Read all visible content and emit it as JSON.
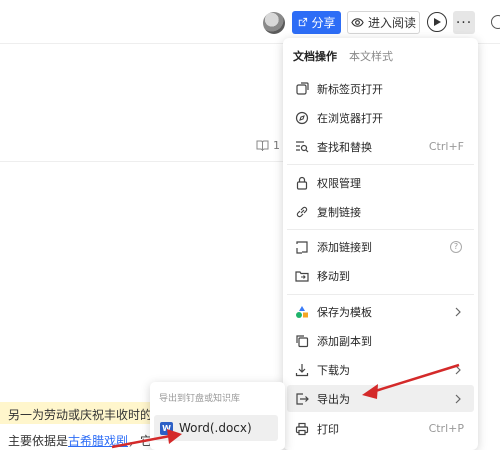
{
  "toolbar": {
    "share_label": "分享",
    "read_label": "进入阅读",
    "more_label": "···"
  },
  "doc": {
    "comment_count": "1",
    "line1": "另一为劳动或庆祝丰收时的",
    "line2_prefix": "主要依据是",
    "line2_link": "古希腊戏剧",
    "line2_suffix": "，它"
  },
  "menu": {
    "tabs": [
      "文档操作",
      "本文样式"
    ],
    "items": [
      {
        "label": "新标签页打开",
        "icon": "new-tab-icon"
      },
      {
        "label": "在浏览器打开",
        "icon": "compass-icon"
      },
      {
        "label": "查找和替换",
        "icon": "find-replace-icon",
        "shortcut": "Ctrl+F"
      },
      {
        "label": "权限管理",
        "icon": "lock-icon"
      },
      {
        "label": "复制链接",
        "icon": "link-icon"
      },
      {
        "label": "添加链接到",
        "icon": "add-link-icon",
        "help": "?"
      },
      {
        "label": "移动到",
        "icon": "move-folder-icon"
      },
      {
        "label": "保存为模板",
        "icon": "template-icon"
      },
      {
        "label": "添加副本到",
        "icon": "copy-icon"
      },
      {
        "label": "下载为",
        "icon": "download-icon"
      },
      {
        "label": "导出为",
        "icon": "export-icon"
      },
      {
        "label": "打印",
        "icon": "print-icon",
        "shortcut": "Ctrl+P"
      }
    ]
  },
  "submenu": {
    "header": "导出到钉盘或知识库",
    "item_label": "Word(.docx)",
    "item_icon_text": "W"
  },
  "colors": {
    "accent": "#2d6df6",
    "arrow": "#d42a2a",
    "highlight": "#fff6cc"
  }
}
